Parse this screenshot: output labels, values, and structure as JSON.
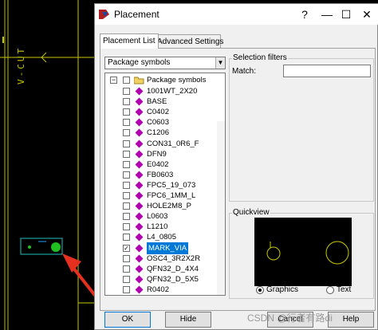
{
  "canvas": {
    "vertical_label": "V-CUT"
  },
  "dialog": {
    "title": "Placement",
    "window_buttons": {
      "help": "?",
      "minimize": "—",
      "maximize": "☐",
      "close": "✕"
    },
    "tabs": [
      "Placement List",
      "Advanced Settings"
    ],
    "dropdown_value": "Package symbols",
    "tree_root": "Package symbols",
    "tree_items": [
      {
        "label": "1001WT_2X20",
        "checked": false,
        "selected": false
      },
      {
        "label": "BASE",
        "checked": false,
        "selected": false
      },
      {
        "label": "C0402",
        "checked": false,
        "selected": false
      },
      {
        "label": "C0603",
        "checked": false,
        "selected": false
      },
      {
        "label": "C1206",
        "checked": false,
        "selected": false
      },
      {
        "label": "CON31_0R6_F",
        "checked": false,
        "selected": false
      },
      {
        "label": "DFN9",
        "checked": false,
        "selected": false
      },
      {
        "label": "E0402",
        "checked": false,
        "selected": false
      },
      {
        "label": "FB0603",
        "checked": false,
        "selected": false
      },
      {
        "label": "FPC5_19_073",
        "checked": false,
        "selected": false
      },
      {
        "label": "FPC6_1MM_L",
        "checked": false,
        "selected": false
      },
      {
        "label": "HOLE2M8_P",
        "checked": false,
        "selected": false
      },
      {
        "label": "L0603",
        "checked": false,
        "selected": false
      },
      {
        "label": "L1210",
        "checked": false,
        "selected": false
      },
      {
        "label": "L4_0805",
        "checked": false,
        "selected": false
      },
      {
        "label": "MARK_VIA",
        "checked": true,
        "selected": true
      },
      {
        "label": "OSC4_3R2X2R",
        "checked": false,
        "selected": false
      },
      {
        "label": "QFN32_D_4X4",
        "checked": false,
        "selected": false
      },
      {
        "label": "QFN32_D_5X5",
        "checked": false,
        "selected": false
      },
      {
        "label": "R0402",
        "checked": false,
        "selected": false
      }
    ],
    "selection_filters": {
      "title": "Selection filters",
      "match_label": "Match:",
      "match_value": ""
    },
    "quickview": {
      "title": "Quickview",
      "options": [
        "Graphics",
        "Text"
      ],
      "selected": "Graphics"
    },
    "buttons": {
      "ok": "OK",
      "hide": "Hide",
      "cancel": "Cancel",
      "help": "Help"
    }
  },
  "watermark": "CSDN @行者有路di"
}
